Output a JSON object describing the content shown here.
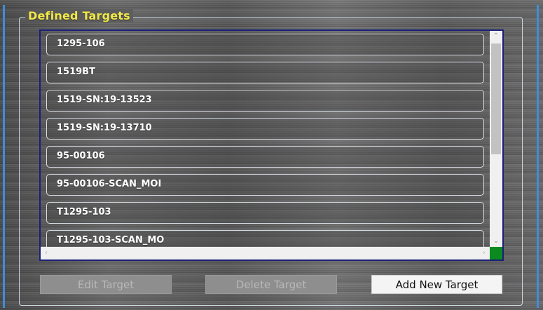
{
  "group": {
    "title": "Defined Targets"
  },
  "targets": [
    "1295-106",
    "1519BT",
    "1519-SN:19-13523",
    "1519-SN:19-13710",
    "95-00106",
    "95-00106-SCAN_MOI",
    "T1295-103",
    "T1295-103-SCAN_MO"
  ],
  "buttons": {
    "edit": "Edit Target",
    "delete": "Delete Target",
    "add": "Add New Target"
  },
  "colors": {
    "title": "#f0e84a",
    "list_border": "#1a1f7a",
    "frame": "#3c8fd8",
    "scroll_corner": "#0a8a1f"
  }
}
